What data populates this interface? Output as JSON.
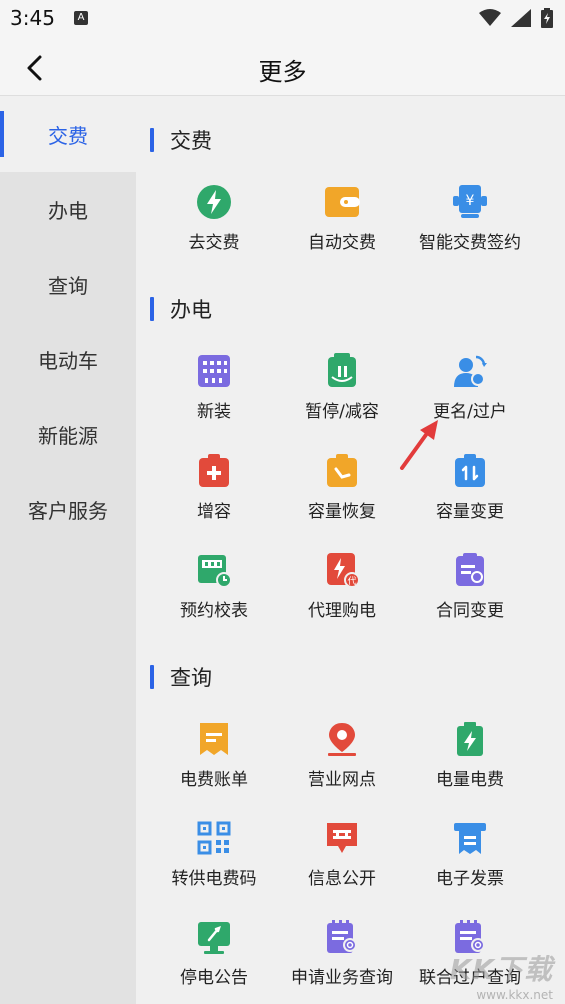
{
  "status_bar": {
    "time": "3:45",
    "notification": "A"
  },
  "nav": {
    "title": "更多"
  },
  "sidebar": {
    "items": [
      {
        "label": "交费",
        "active": true
      },
      {
        "label": "办电"
      },
      {
        "label": "查询"
      },
      {
        "label": "电动车"
      },
      {
        "label": "新能源"
      },
      {
        "label": "客户服务"
      }
    ]
  },
  "sections": [
    {
      "title": "交费",
      "items": [
        {
          "label": "去交费",
          "icon": "lightning-pay-icon"
        },
        {
          "label": "自动交费",
          "icon": "wallet-icon"
        },
        {
          "label": "智能交费签约",
          "icon": "yuan-contract-icon"
        }
      ]
    },
    {
      "title": "办电",
      "items": [
        {
          "label": "新装",
          "icon": "meter-icon"
        },
        {
          "label": "暂停/减容",
          "icon": "pause-icon"
        },
        {
          "label": "更名/过户",
          "icon": "user-transfer-icon"
        },
        {
          "label": "增容",
          "icon": "capacity-plus-icon"
        },
        {
          "label": "容量恢复",
          "icon": "capacity-restore-icon"
        },
        {
          "label": "容量变更",
          "icon": "capacity-change-icon"
        },
        {
          "label": "预约校表",
          "icon": "appointment-meter-icon"
        },
        {
          "label": "代理购电",
          "icon": "agent-power-icon"
        },
        {
          "label": "合同变更",
          "icon": "contract-change-icon"
        }
      ]
    },
    {
      "title": "查询",
      "items": [
        {
          "label": "电费账单",
          "icon": "bill-icon"
        },
        {
          "label": "营业网点",
          "icon": "location-icon"
        },
        {
          "label": "电量电费",
          "icon": "battery-icon"
        },
        {
          "label": "转供电费码",
          "icon": "qr-code-icon"
        },
        {
          "label": "信息公开",
          "icon": "info-public-icon"
        },
        {
          "label": "电子发票",
          "icon": "invoice-icon"
        },
        {
          "label": "停电公告",
          "icon": "outage-icon"
        },
        {
          "label": "申请业务查询",
          "icon": "application-query-icon"
        },
        {
          "label": "联合过户查询",
          "icon": "joint-transfer-query-icon"
        }
      ]
    }
  ],
  "watermark": {
    "brand": "KK下载",
    "url": "www.kkx.net"
  },
  "colors": {
    "accent": "#2b63e6",
    "green": "#2fa86b",
    "orange": "#f1a629",
    "purple": "#7b6be0",
    "red": "#e24a3b",
    "blue": "#3a8ee6"
  }
}
